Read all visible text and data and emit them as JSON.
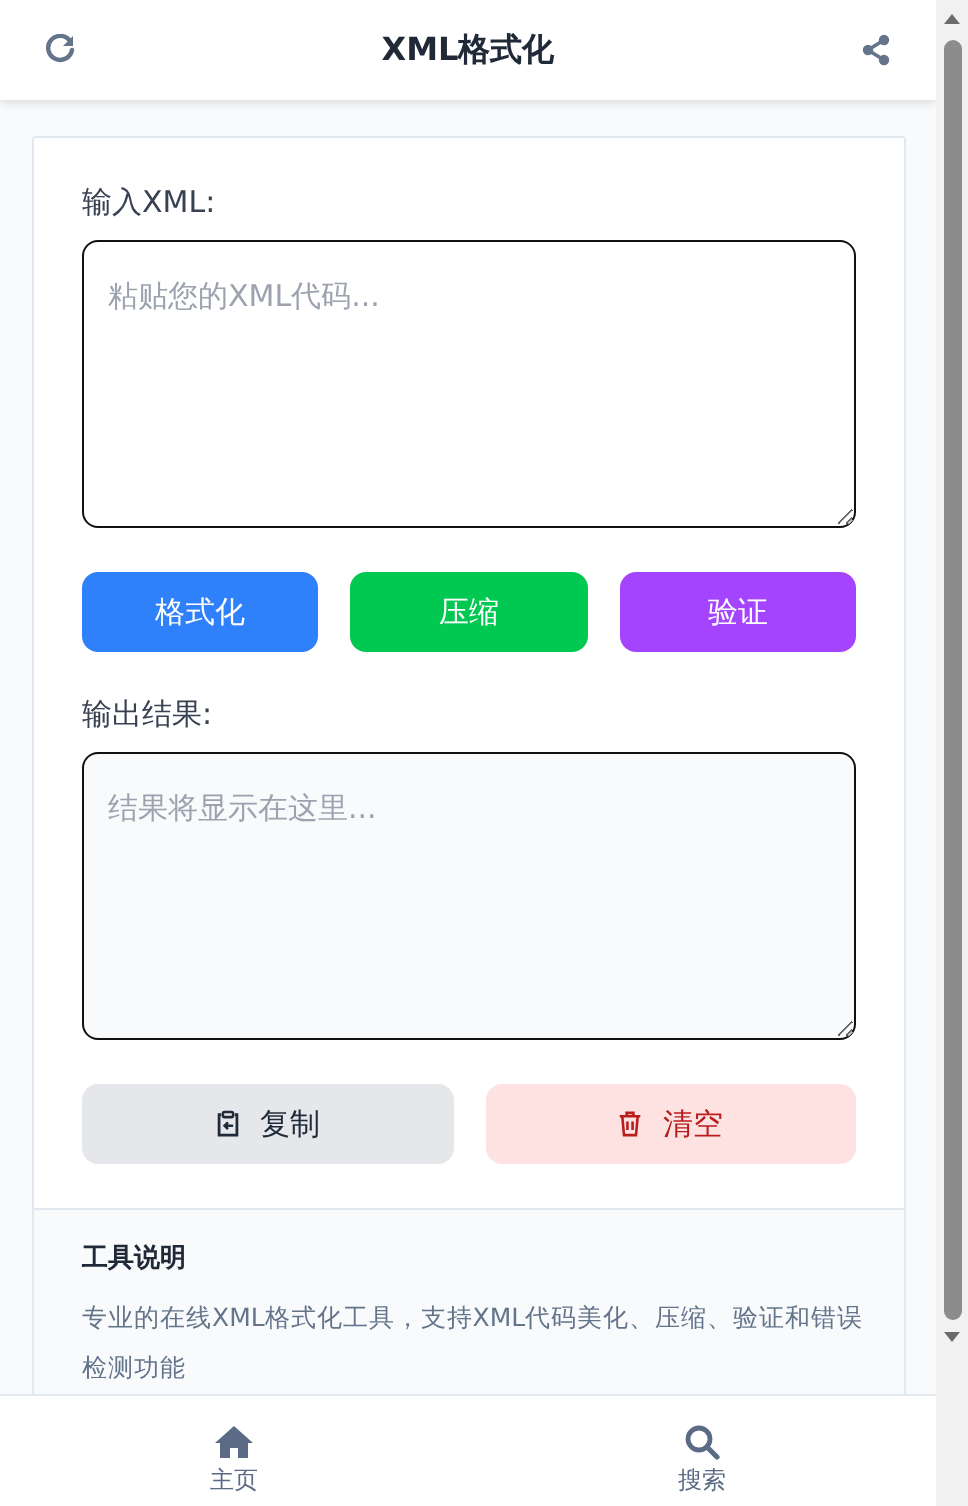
{
  "header": {
    "title": "XML格式化"
  },
  "input": {
    "label": "输入XML:",
    "placeholder": "粘贴您的XML代码..."
  },
  "actions": [
    {
      "label": "格式化",
      "kind": "format"
    },
    {
      "label": "压缩",
      "kind": "compress"
    },
    {
      "label": "验证",
      "kind": "validate"
    }
  ],
  "output": {
    "label": "输出结果:",
    "placeholder": "结果将显示在这里..."
  },
  "output_actions": [
    {
      "label": "复制",
      "kind": "copy"
    },
    {
      "label": "清空",
      "kind": "clear"
    }
  ],
  "info": {
    "title": "工具说明",
    "text": "专业的在线XML格式化工具，支持XML代码美化、压缩、验证和错误检测功能"
  },
  "nav": [
    {
      "label": "主页",
      "kind": "home"
    },
    {
      "label": "搜索",
      "kind": "search"
    }
  ]
}
